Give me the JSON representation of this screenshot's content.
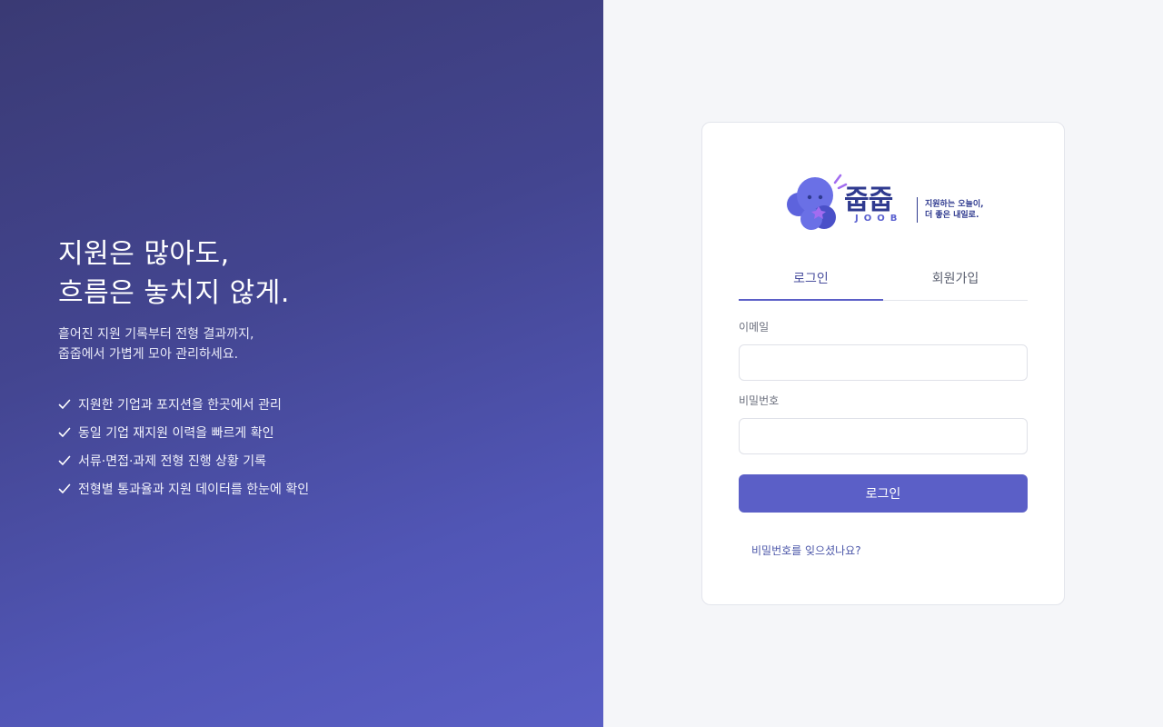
{
  "hero": {
    "title_line1": "지원은 많아도,",
    "title_line2": "흐름은 놓치지 않게.",
    "sub_line1": "흩어진 지원 기록부터 전형 결과까지,",
    "sub_line2": "줍줍에서 가볍게 모아 관리하세요.",
    "features": [
      "지원한 기업과 포지션을 한곳에서 관리",
      "동일 기업 재지원 이력을 빠르게 확인",
      "서류·면접·과제 전형 진행 상황 기록",
      "전형별 통과율과 지원 데이터를 한눈에 확인"
    ]
  },
  "logo": {
    "word": "줍줍",
    "sub": "JOOB",
    "tagline_line1": "지원하는 오늘이,",
    "tagline_line2": "더 좋은 내일로."
  },
  "tabs": {
    "login": "로그인",
    "signup": "회원가입"
  },
  "form": {
    "email_label": "이메일",
    "email_value": "",
    "password_label": "비밀번호",
    "password_value": "",
    "submit_label": "로그인",
    "forgot_label": "비밀번호를 잊으셨나요?"
  },
  "colors": {
    "accent": "#5b5fc7",
    "gradient_start": "#3a3a74",
    "gradient_end": "#5a5fc5",
    "logo_navy": "#2f3a8f"
  },
  "icons": {
    "feature_bullet": "check-icon",
    "logo_mark": "joob-mascot-icon"
  }
}
